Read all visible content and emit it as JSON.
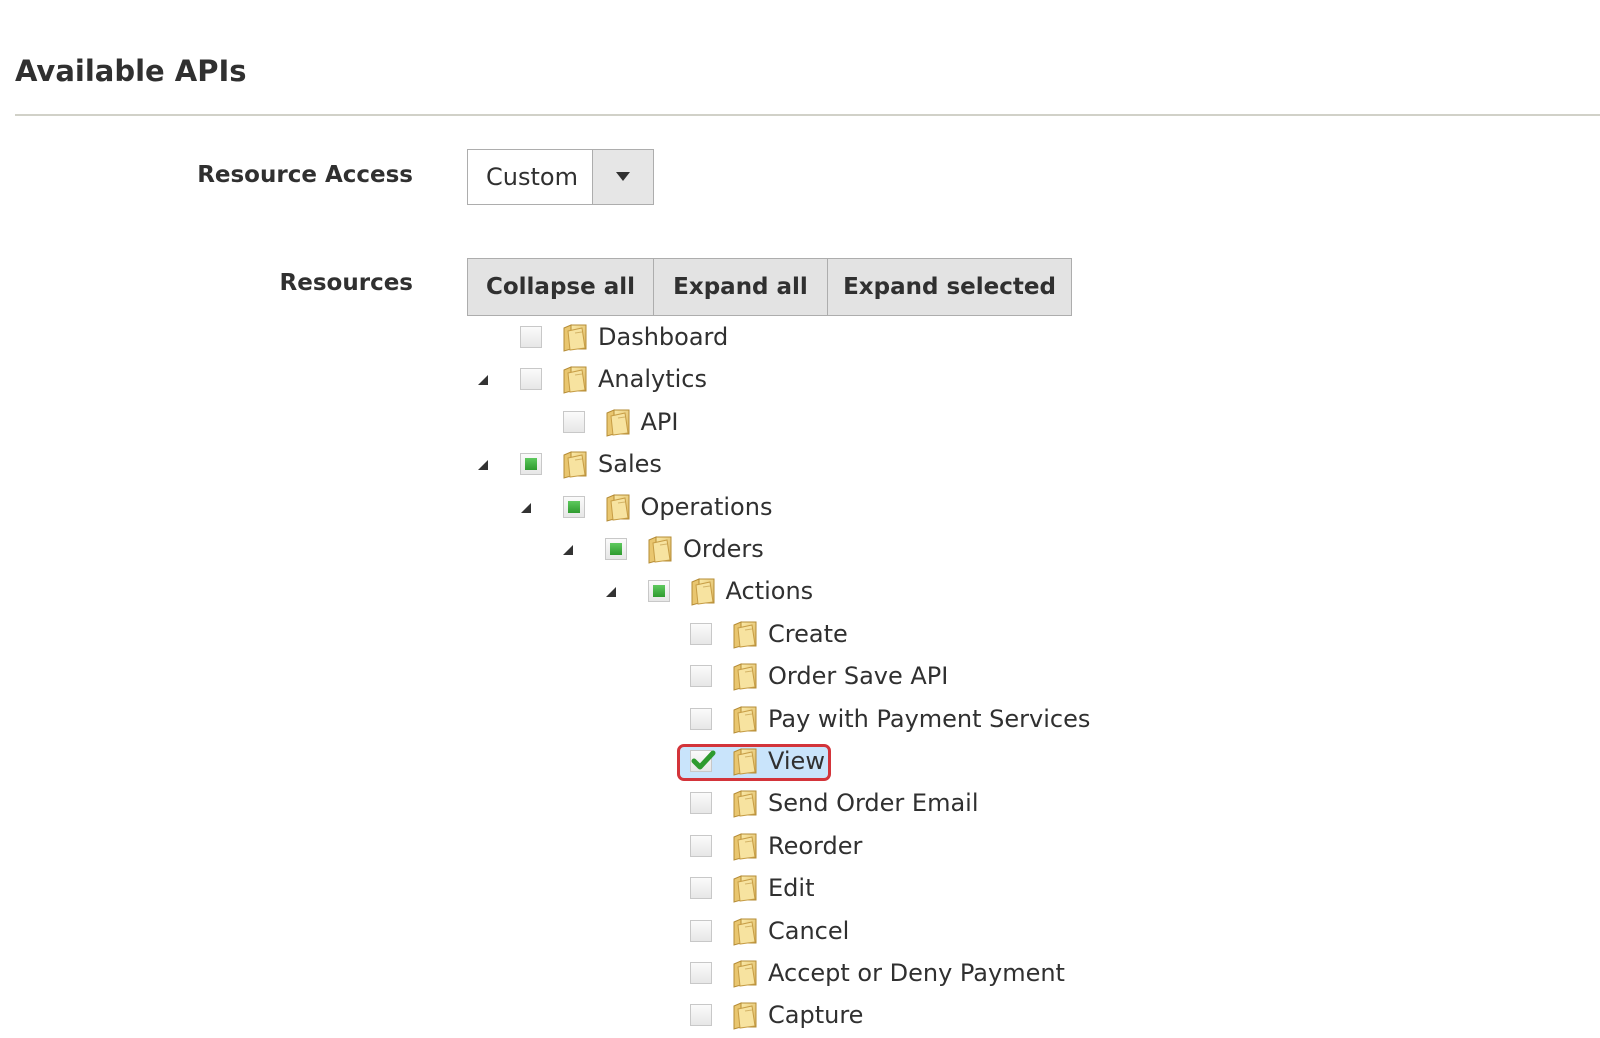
{
  "section": {
    "title": "Available APIs"
  },
  "resource_access": {
    "label": "Resource Access",
    "selected": "Custom",
    "arrow_icon": "triangle-down-icon"
  },
  "resources": {
    "label": "Resources",
    "buttons": {
      "collapse_all": "Collapse all",
      "expand_all": "Expand all",
      "expand_selected": "Expand selected"
    }
  },
  "tree": [
    {
      "id": "dashboard",
      "label": "Dashboard",
      "state": "unchecked",
      "expanded": null
    },
    {
      "id": "analytics",
      "label": "Analytics",
      "state": "unchecked",
      "expanded": true
    },
    {
      "id": "api",
      "label": "API",
      "state": "unchecked",
      "expanded": null
    },
    {
      "id": "sales",
      "label": "Sales",
      "state": "partial",
      "expanded": true
    },
    {
      "id": "operations",
      "label": "Operations",
      "state": "partial",
      "expanded": true
    },
    {
      "id": "orders",
      "label": "Orders",
      "state": "partial",
      "expanded": true
    },
    {
      "id": "actions",
      "label": "Actions",
      "state": "partial",
      "expanded": true
    },
    {
      "id": "create",
      "label": "Create",
      "state": "unchecked",
      "expanded": null
    },
    {
      "id": "order-save-api",
      "label": "Order Save API",
      "state": "unchecked",
      "expanded": null
    },
    {
      "id": "pay-with-payment-services",
      "label": "Pay with Payment Services",
      "state": "unchecked",
      "expanded": null
    },
    {
      "id": "view",
      "label": "View",
      "state": "checked",
      "expanded": null,
      "highlighted": true
    },
    {
      "id": "send-order-email",
      "label": "Send Order Email",
      "state": "unchecked",
      "expanded": null
    },
    {
      "id": "reorder",
      "label": "Reorder",
      "state": "unchecked",
      "expanded": null
    },
    {
      "id": "edit",
      "label": "Edit",
      "state": "unchecked",
      "expanded": null
    },
    {
      "id": "cancel",
      "label": "Cancel",
      "state": "unchecked",
      "expanded": null
    },
    {
      "id": "accept-or-deny-payment",
      "label": "Accept or Deny Payment",
      "state": "unchecked",
      "expanded": null
    },
    {
      "id": "capture",
      "label": "Capture",
      "state": "unchecked",
      "expanded": null
    }
  ],
  "colors": {
    "partial_fill": "#3aa83a",
    "highlight_border": "#d3343a",
    "highlight_bg": "#c9e4fb"
  }
}
